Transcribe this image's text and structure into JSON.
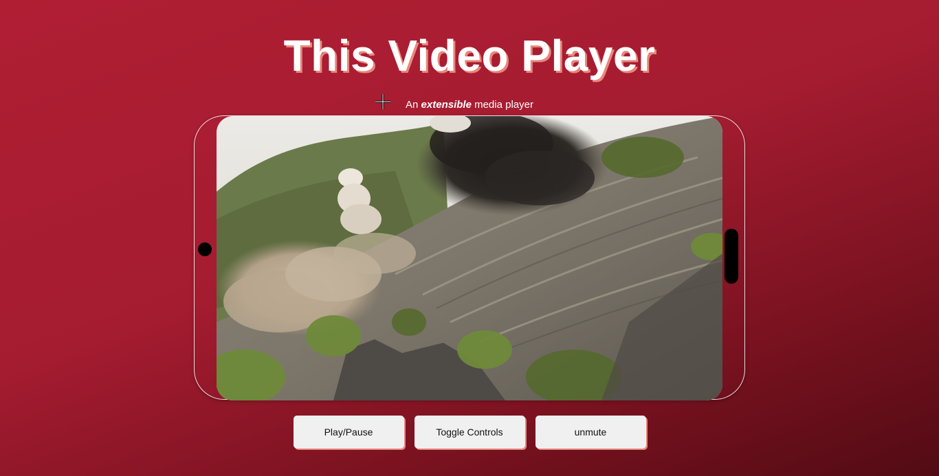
{
  "header": {
    "title": "This Video Player",
    "subtitle_lead": "An ",
    "subtitle_emph": "extensible",
    "subtitle_trail": " media player"
  },
  "video": {
    "scene": "hillside-explosion-video-frame"
  },
  "controls": {
    "play_pause_label": "Play/Pause",
    "toggle_controls_label": "Toggle Controls",
    "unmute_label": "unmute"
  },
  "colors": {
    "background_start": "#b01e34",
    "background_end": "#520b14",
    "title_shadow": "#e8877c",
    "button_bg": "#f0f0f0"
  }
}
